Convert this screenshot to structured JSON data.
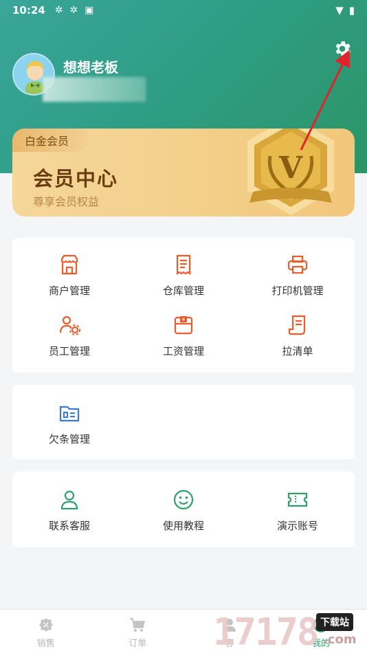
{
  "status_bar": {
    "time": "10:24"
  },
  "profile": {
    "username": "想想老板"
  },
  "vip_card": {
    "tag": "白金会员",
    "title": "会员中心",
    "subtitle": "尊享会员权益",
    "badge_letter": "V"
  },
  "management": [
    {
      "label": "商户管理",
      "icon": "store-icon"
    },
    {
      "label": "仓库管理",
      "icon": "receipt-icon"
    },
    {
      "label": "打印机管理",
      "icon": "printer-icon"
    },
    {
      "label": "员工管理",
      "icon": "staff-settings-icon"
    },
    {
      "label": "工资管理",
      "icon": "wallet-icon"
    },
    {
      "label": "拉清单",
      "icon": "list-document-icon"
    }
  ],
  "debt": [
    {
      "label": "欠条管理",
      "icon": "folder-icon"
    }
  ],
  "support": [
    {
      "label": "联系客服",
      "icon": "person-icon"
    },
    {
      "label": "使用教程",
      "icon": "smile-icon"
    },
    {
      "label": "演示账号",
      "icon": "ticket-icon"
    }
  ],
  "tabbar": [
    {
      "label": "销售",
      "icon": "discount-icon"
    },
    {
      "label": "订单",
      "icon": "cart-icon"
    },
    {
      "label": "客",
      "icon": "customer-icon"
    },
    {
      "label": "我的",
      "icon": "profile-icon"
    }
  ],
  "watermark": {
    "digits": "17178",
    "text": "下载站",
    "suffix": ".com"
  },
  "colors": {
    "accent_orange": "#ef5a2a",
    "blue_icon": "#3a79d6",
    "green_icon": "#2fa06a",
    "header_green": "#2f9e86"
  }
}
